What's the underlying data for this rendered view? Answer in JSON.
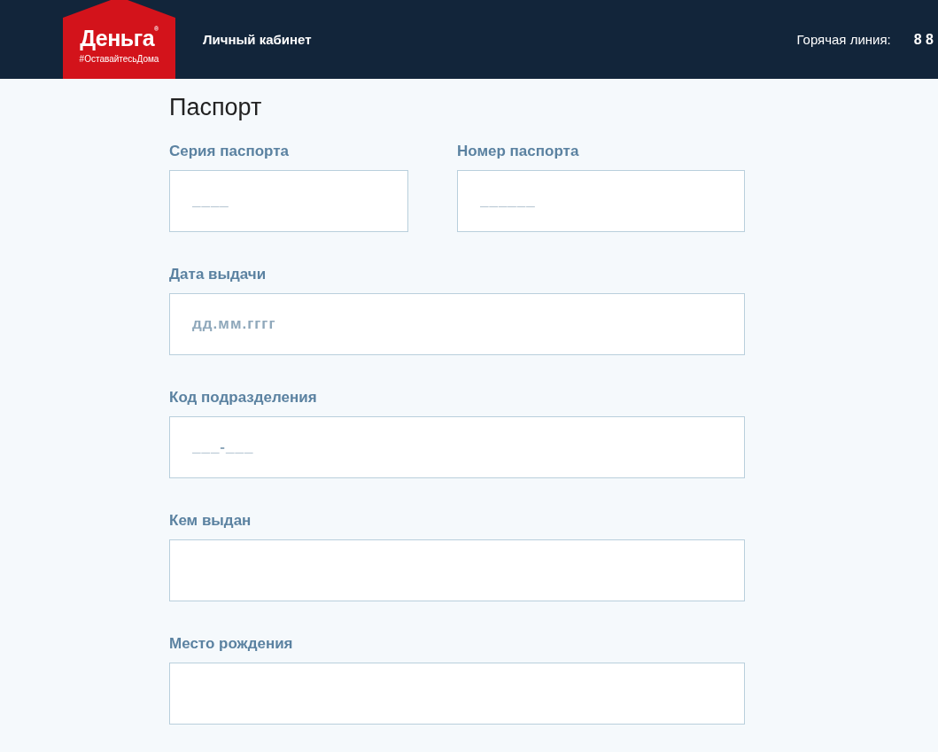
{
  "header": {
    "logo": {
      "name": "Деньга$^{®}$",
      "tagline": "#ОставайтесьДома"
    },
    "nav_link": "Личный кабинет",
    "hotline": {
      "label": "Горячая линия:",
      "phone": "8 8"
    }
  },
  "section": {
    "title": "Паспорт",
    "rows": [
      [
        {
          "label": "Серия паспорта",
          "placeholder": "____"
        },
        {
          "label": "Номер паспорта",
          "placeholder": "______"
        }
      ],
      [
        {
          "label": "Дата выдачи",
          "placeholder": "дд.мм.гггг"
        }
      ],
      [
        {
          "label": "Код подразделения",
          "placeholder": "___-___"
        }
      ],
      [
        {
          "label": "Кем выдан"
        }
      ],
      [
        {
          "label": "Место рождения"
        }
      ]
    ]
  }
}
